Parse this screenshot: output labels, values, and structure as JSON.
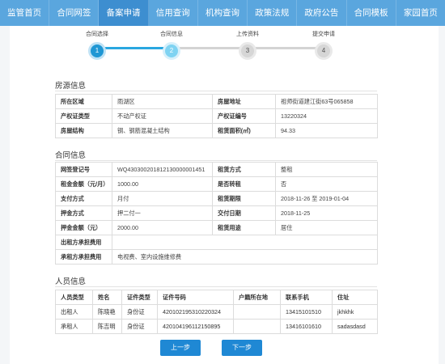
{
  "nav": {
    "tabs": [
      "监管首页",
      "合同网签",
      "备案申请",
      "信用查询",
      "机构查询",
      "政策法规",
      "政府公告",
      "合同模板",
      "家园首页"
    ]
  },
  "steps": [
    {
      "label": "合同选择",
      "num": "1"
    },
    {
      "label": "合同信息",
      "num": "2"
    },
    {
      "label": "上传资料",
      "num": "3"
    },
    {
      "label": "提交申请",
      "num": "4"
    }
  ],
  "house": {
    "title": "房源信息",
    "rows": [
      {
        "k1": "所在区域",
        "v1": "雨湖区",
        "k2": "房屋地址",
        "v2": "祖师街道建江街63号065858"
      },
      {
        "k1": "产权证类型",
        "v1": "不动产权证",
        "k2": "产权证编号",
        "v2": "13220324"
      },
      {
        "k1": "房屋结构",
        "v1": "钢、钢筋混凝土结构",
        "k2": "租赁面积(㎡)",
        "v2": "94.33"
      }
    ]
  },
  "contract": {
    "title": "合同信息",
    "rows": [
      {
        "k1": "网签登记号",
        "v1": "WQ430300201812130000001451",
        "k2": "租赁方式",
        "v2": "整租"
      },
      {
        "k1": "租金金额（元/月）",
        "v1": "1000.00",
        "k2": "是否转租",
        "v2": "否"
      },
      {
        "k1": "支付方式",
        "v1": "月付",
        "k2": "租赁期限",
        "v2": "2018-11-26 至 2019-01-04"
      },
      {
        "k1": "押金方式",
        "v1": "押二付一",
        "k2": "交付日期",
        "v2": "2018-11-25"
      },
      {
        "k1": "押金金额（元）",
        "v1": "2000.00",
        "k2": "租赁用途",
        "v2": "居住"
      }
    ],
    "lessor_fee_label": "出租方承担费用",
    "lessor_fee_value": "",
    "lessee_fee_label": "承租方承担费用",
    "lessee_fee_value": "电视费、室内设施维修费"
  },
  "people": {
    "title": "人员信息",
    "headers": [
      "人员类型",
      "姓名",
      "证件类型",
      "证件号码",
      "户籍所在地",
      "联系手机",
      "住址"
    ],
    "rows": [
      [
        "出租人",
        "陈晓艳",
        "身份证",
        "420102195310220324",
        "",
        "13415101510",
        "jkhkhk"
      ],
      [
        "承租人",
        "陈吉明",
        "身份证",
        "420104196112150895",
        "",
        "13416101610",
        "sadasdasd"
      ]
    ]
  },
  "buttons": {
    "prev": "上一步",
    "next": "下一步"
  }
}
